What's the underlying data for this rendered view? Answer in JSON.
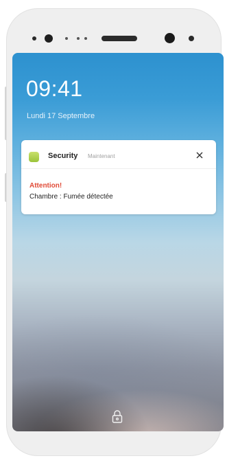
{
  "lockscreen": {
    "time": "09:41",
    "date": "Lundi 17 Septembre"
  },
  "notification": {
    "app_icon": "security-app-icon",
    "app_name": "Security",
    "timestamp": "Maintenant",
    "close_icon": "close-icon",
    "title": "Attention!",
    "body": "Chambre : Fumée détectée",
    "title_color": "#e04a36",
    "app_icon_color": "#aacd45"
  },
  "footer": {
    "lock_icon": "lock-icon"
  }
}
